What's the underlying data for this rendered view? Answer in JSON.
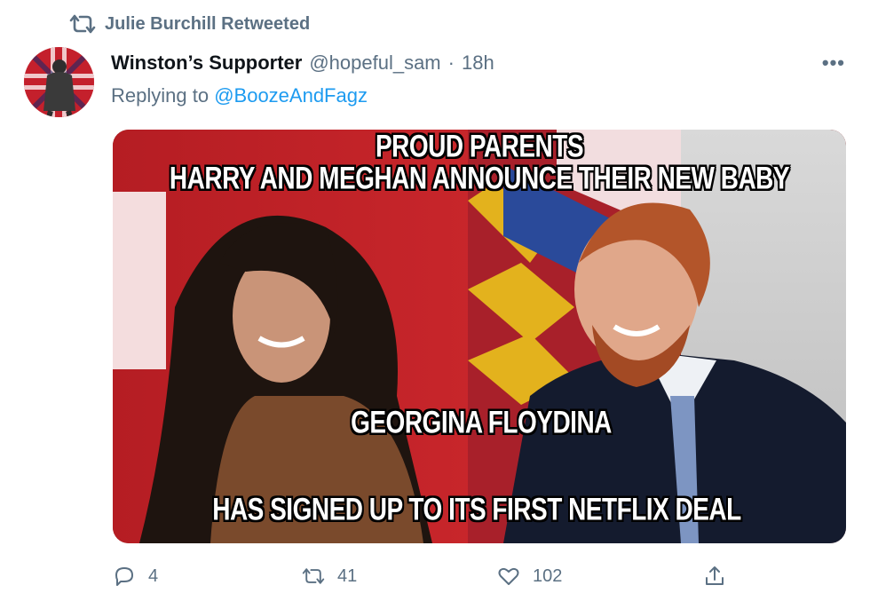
{
  "retweet_banner": {
    "icon": "retweet-icon",
    "text": "Julie Burchill Retweeted"
  },
  "author": {
    "display_name": "Winston’s Supporter",
    "handle": "@hopeful_sam",
    "separator": "·",
    "time": "18h"
  },
  "reply": {
    "prefix": "Replying to",
    "target": "@BoozeAndFagz"
  },
  "more_icon": "more-icon",
  "media": {
    "caption_line1": "PROUD PARENTS",
    "caption_line2": "HARRY AND MEGHAN ANNOUNCE THEIR NEW BABY",
    "caption_line3": "GEORGINA FLOYDINA",
    "caption_line4": "HAS SIGNED UP TO ITS FIRST NETFLIX DEAL"
  },
  "actions": {
    "reply_count": "4",
    "retweet_count": "41",
    "like_count": "102"
  },
  "colors": {
    "secondary_text": "#5b7083",
    "link": "#1d9bf0",
    "primary_text": "#0f1419"
  }
}
